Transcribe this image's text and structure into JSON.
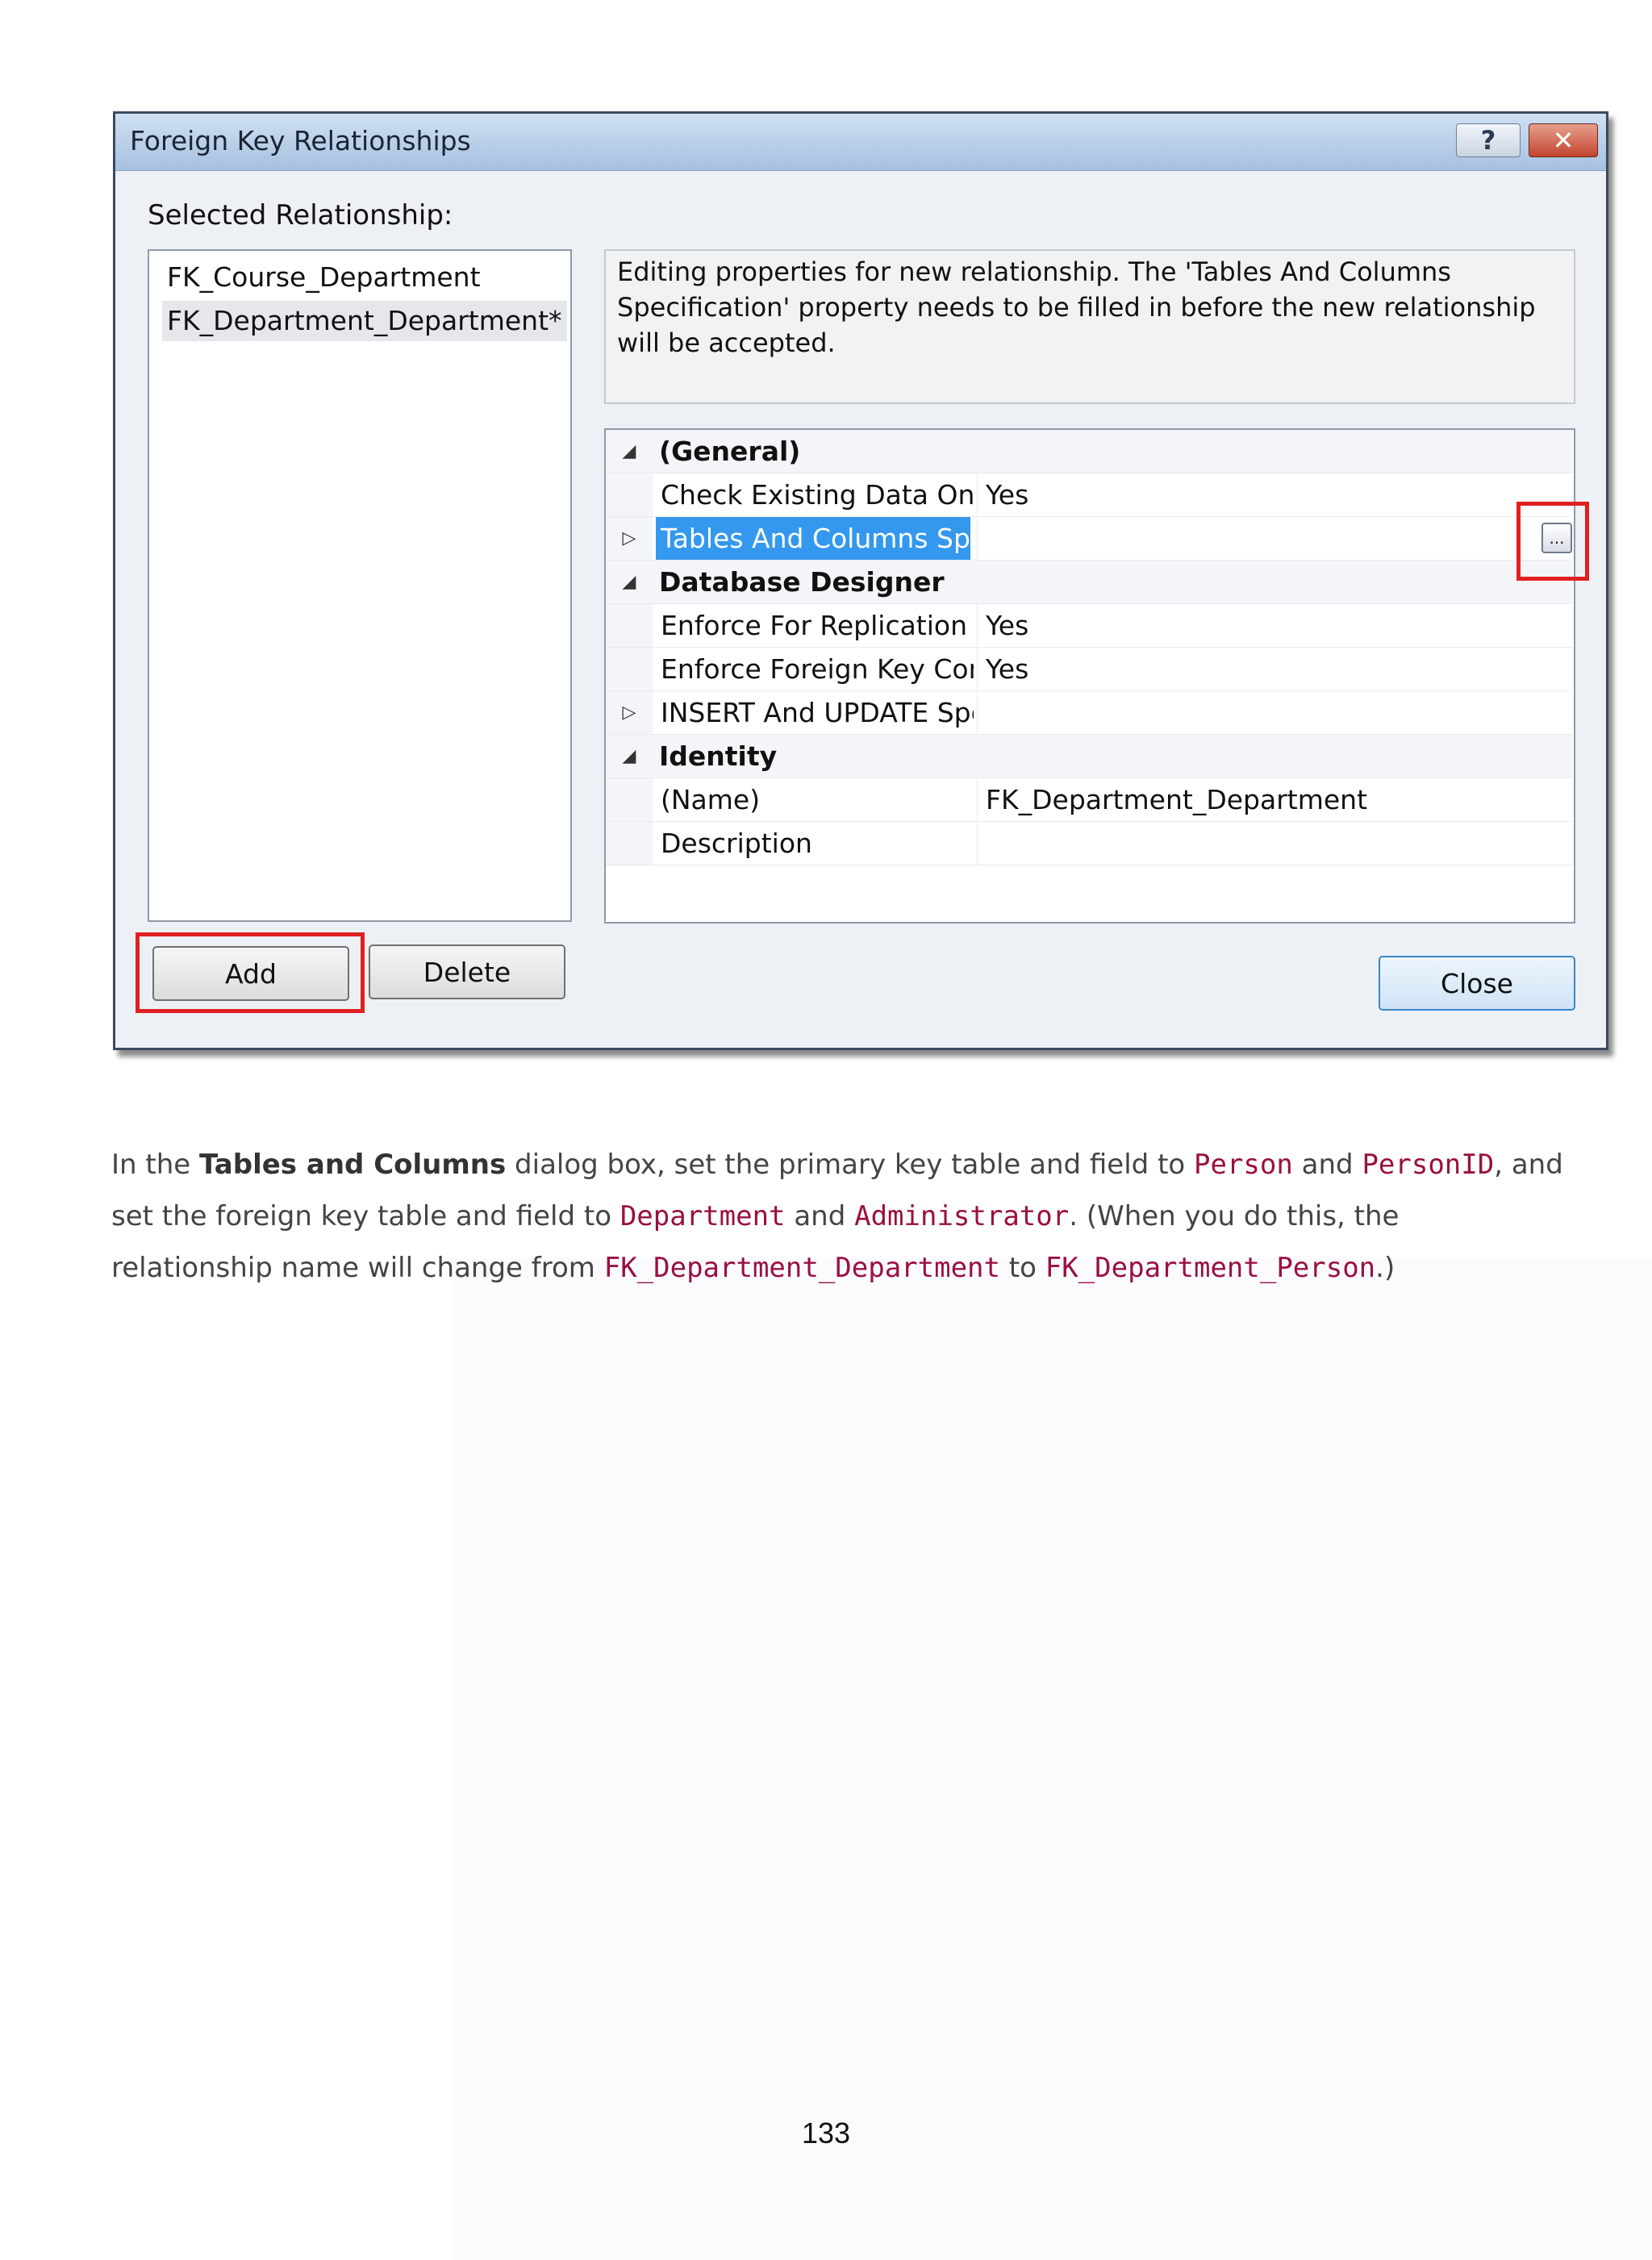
{
  "dialog": {
    "title": "Foreign Key Relationships",
    "help_button": "?",
    "close_button": "✕",
    "selected_relationship_label": "Selected Relationship:",
    "relationships": [
      "FK_Course_Department",
      "FK_Department_Department*"
    ],
    "selected_index": 1,
    "info_text": "Editing properties for new relationship.  The 'Tables And Columns Specification' property needs to be filled in before the new relationship will be accepted.",
    "properties": {
      "general": {
        "category": "(General)",
        "rows": [
          {
            "name": "Check Existing Data On Creati",
            "value": "Yes"
          },
          {
            "name": "Tables And Columns Specific",
            "value": "",
            "ellipsis": "..."
          }
        ]
      },
      "database_designer": {
        "category": "Database Designer",
        "rows": [
          {
            "name": "Enforce For Replication",
            "value": "Yes"
          },
          {
            "name": "Enforce Foreign Key Constrair",
            "value": "Yes"
          },
          {
            "name": "INSERT And UPDATE Specific",
            "value": ""
          }
        ]
      },
      "identity": {
        "category": "Identity",
        "rows": [
          {
            "name": "(Name)",
            "value": "FK_Department_Department"
          },
          {
            "name": "Description",
            "value": ""
          }
        ]
      }
    },
    "buttons": {
      "add": "Add",
      "delete": "Delete",
      "close": "Close"
    },
    "highlight_color": "#3398ee",
    "annotation_color": "#e02020"
  },
  "paragraph": {
    "t1": "In the ",
    "bold1": "Tables and Columns",
    "t2": " dialog box, set the primary key table and field to ",
    "c1": "Person",
    "t3": " and ",
    "c2": "PersonID",
    "t4": ", and set the foreign key table and field to ",
    "c3": "Department",
    "t5": " and ",
    "c4": "Administrator",
    "t6": ". (When you do this, the relationship name will change from ",
    "c5": "FK_Department_Department",
    "t7": " to ",
    "c6": "FK_Department_Person",
    "t8": ".)"
  },
  "page_number": "133"
}
